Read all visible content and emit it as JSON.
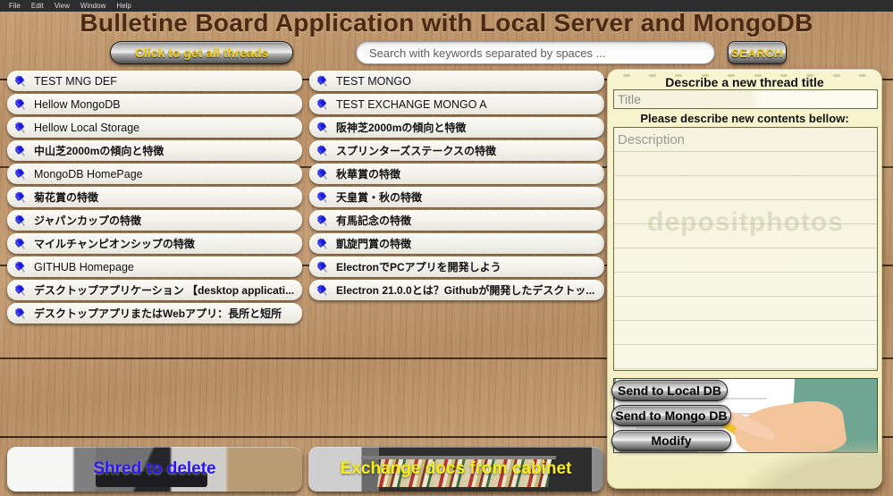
{
  "menubar": {
    "items": [
      "File",
      "Edit",
      "View",
      "Window",
      "Help"
    ]
  },
  "header": {
    "title": "Bulletine Board Application with Local Server and MongoDB"
  },
  "toolbar": {
    "get_all_label": "Click to get all threads",
    "search_placeholder": "Search with keywords separated by spaces ...",
    "search_value": "",
    "search_button_label": "SEARCH"
  },
  "threads": {
    "icon": "pushpin-icon",
    "left_column": [
      {
        "title": "TEST MNG DEF",
        "jp": false
      },
      {
        "title": "Hellow MongoDB",
        "jp": false
      },
      {
        "title": "Hellow Local Storage",
        "jp": false
      },
      {
        "title": "中山芝2000mの傾向と特徴",
        "jp": true
      },
      {
        "title": "MongoDB HomePage",
        "jp": false
      },
      {
        "title": "菊花賞の特徴",
        "jp": true
      },
      {
        "title": "ジャパンカップの特徴",
        "jp": true
      },
      {
        "title": "マイルチャンピオンシップの特徴",
        "jp": true
      },
      {
        "title": "GITHUB Homepage",
        "jp": false
      },
      {
        "title": "デスクトップアプリケーション 【desktop applicati...",
        "jp": true
      },
      {
        "title": "デスクトップアプリまたはWebアプリ：長所と短所",
        "jp": true
      }
    ],
    "right_column": [
      {
        "title": "TEST MONGO",
        "jp": false
      },
      {
        "title": "TEST EXCHANGE MONGO A",
        "jp": false
      },
      {
        "title": "阪神芝2000mの傾向と特徴",
        "jp": true
      },
      {
        "title": "スプリンターズステークスの特徴",
        "jp": true
      },
      {
        "title": "秋華賞の特徴",
        "jp": true
      },
      {
        "title": "天皇賞・秋の特徴",
        "jp": true
      },
      {
        "title": "有馬記念の特徴",
        "jp": true
      },
      {
        "title": "凱旋門賞の特徴",
        "jp": true
      },
      {
        "title": "ElectronでPCアプリを開発しよう",
        "jp": true
      },
      {
        "title": "Electron 21.0.0とは？Githubが開発したデスクトッ...",
        "jp": true
      }
    ]
  },
  "bottom_panels": [
    {
      "label": "Shred to delete",
      "color": "#2b18e8",
      "icon": "shredder-image"
    },
    {
      "label": "Exchange docs from cabinet",
      "color": "#f7ef1b",
      "icon": "file-cabinet-image"
    }
  ],
  "notepad": {
    "title_heading": "Describe a new thread title",
    "title_placeholder": "Title",
    "title_value": "",
    "contents_heading": "Please describe new contents bellow:",
    "description_placeholder": "Description",
    "description_value": "",
    "watermark": "depositphotos",
    "illustration": "hand-writing-with-pencil-image",
    "buttons": [
      {
        "label": "Send to Local DB"
      },
      {
        "label": "Send to Mongo DB"
      },
      {
        "label": "Modify"
      }
    ]
  },
  "colors": {
    "title_text": "#4a2a13",
    "button_text": "#f5d012",
    "pin": "#1b1bdd",
    "notepad_bg": "#f6f2c8"
  }
}
